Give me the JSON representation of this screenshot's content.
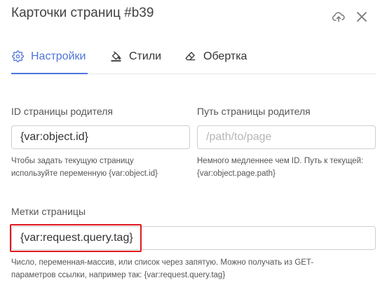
{
  "header": {
    "title": "Карточки страниц #b39",
    "upload_icon": "cloud-upload-icon",
    "close_icon": "close-icon"
  },
  "tabs": [
    {
      "label": "Настройки",
      "icon": "gear-icon",
      "active": true
    },
    {
      "label": "Стили",
      "icon": "paint-bucket-icon",
      "active": false
    },
    {
      "label": "Обертка",
      "icon": "eraser-icon",
      "active": false
    }
  ],
  "fields": {
    "parent_id": {
      "label": "ID страницы родителя",
      "value": "{var:object.id}",
      "help_line1": "Чтобы задать текущую страницу",
      "help_line2": "используйте переменную {var:object.id}"
    },
    "parent_path": {
      "label": "Путь страницы родителя",
      "value": "",
      "placeholder": "/path/to/page",
      "help_line1": "Немного медленнее чем ID. Путь к текущей:",
      "help_line2": "{var:object.page.path}"
    },
    "tags": {
      "label": "Метки страницы",
      "value": "{var:request.query.tag}",
      "help_line1": "Число, переменная-массив, или список через запятую. Можно получать из GET-",
      "help_line2": "параметров ссылки, например так: {var:request.query.tag}"
    }
  },
  "colors": {
    "accent": "#4f74d9",
    "highlight": "#e0191f",
    "border": "#cfcfcf"
  }
}
